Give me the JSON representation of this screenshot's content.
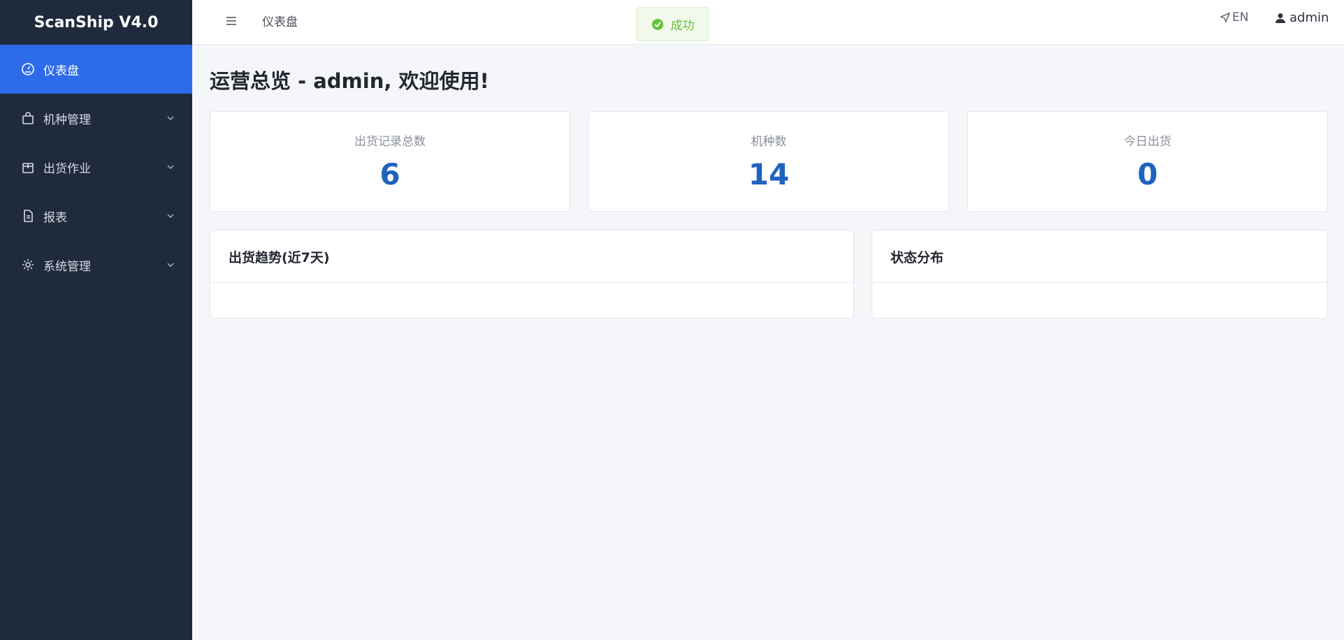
{
  "app": {
    "brand": "ScanShip V4.0"
  },
  "sidebar": {
    "items": [
      {
        "label": "仪表盘",
        "icon": "dashboard-icon"
      },
      {
        "label": "机种管理",
        "icon": "bag-icon"
      },
      {
        "label": "出货作业",
        "icon": "box-icon"
      },
      {
        "label": "报表",
        "icon": "document-icon"
      },
      {
        "label": "系统管理",
        "icon": "gear-icon"
      }
    ]
  },
  "topbar": {
    "breadcrumb": "仪表盘",
    "lang": "EN",
    "user": "admin"
  },
  "toast": {
    "message": "成功",
    "color": "#67c23a"
  },
  "main": {
    "title": "运营总览 - admin, 欢迎使用!",
    "stats": [
      {
        "label": "出货记录总数",
        "value": "6"
      },
      {
        "label": "机种数",
        "value": "14"
      },
      {
        "label": "今日出货",
        "value": "0"
      }
    ],
    "panels": [
      {
        "title": "出货趋势(近7天)"
      },
      {
        "title": "状态分布"
      }
    ]
  },
  "colors": {
    "sidebar_bg": "#1f2a3c",
    "active_bg": "#2d6be9",
    "stat_value": "#1f63c0",
    "page_bg": "#f5f6fa"
  }
}
